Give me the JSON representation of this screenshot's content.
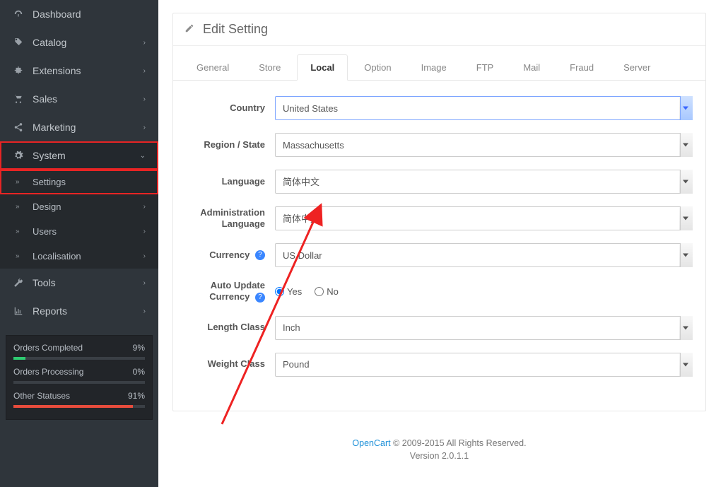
{
  "sidebar": {
    "items": [
      {
        "label": "Dashboard",
        "icon": "dashboard-icon"
      },
      {
        "label": "Catalog",
        "icon": "tag-icon",
        "chevron": true
      },
      {
        "label": "Extensions",
        "icon": "puzzle-icon",
        "chevron": true
      },
      {
        "label": "Sales",
        "icon": "cart-icon",
        "chevron": true
      },
      {
        "label": "Marketing",
        "icon": "share-icon",
        "chevron": true
      },
      {
        "label": "System",
        "icon": "gear-icon",
        "chevron": true,
        "expanded": true,
        "children": [
          {
            "label": "Settings"
          },
          {
            "label": "Design",
            "chevron": true
          },
          {
            "label": "Users",
            "chevron": true
          },
          {
            "label": "Localisation",
            "chevron": true
          }
        ]
      },
      {
        "label": "Tools",
        "icon": "wrench-icon",
        "chevron": true
      },
      {
        "label": "Reports",
        "icon": "chart-icon",
        "chevron": true
      }
    ]
  },
  "stats": [
    {
      "label": "Orders Completed",
      "pct": "9%",
      "fill": 9,
      "color": "green"
    },
    {
      "label": "Orders Processing",
      "pct": "0%",
      "fill": 0,
      "color": "blue"
    },
    {
      "label": "Other Statuses",
      "pct": "91%",
      "fill": 91,
      "color": "red"
    }
  ],
  "panel": {
    "title": "Edit Setting"
  },
  "tabs": [
    "General",
    "Store",
    "Local",
    "Option",
    "Image",
    "FTP",
    "Mail",
    "Fraud",
    "Server"
  ],
  "active_tab": "Local",
  "form": {
    "country": {
      "label": "Country",
      "value": "United States"
    },
    "region": {
      "label": "Region / State",
      "value": "Massachusetts"
    },
    "language": {
      "label": "Language",
      "value": "简体中文"
    },
    "admin_language": {
      "label": "Administration Language",
      "value": "简体中文"
    },
    "currency": {
      "label": "Currency",
      "value": "US Dollar",
      "info": true
    },
    "auto_update_currency": {
      "label": "Auto Update Currency",
      "info": true,
      "yes": "Yes",
      "no": "No",
      "selected": "yes"
    },
    "length_class": {
      "label": "Length Class",
      "value": "Inch"
    },
    "weight_class": {
      "label": "Weight Class",
      "value": "Pound"
    }
  },
  "footer": {
    "brand": "OpenCart",
    "rights": " © 2009-2015 All Rights Reserved.",
    "version": "Version 2.0.1.1"
  }
}
